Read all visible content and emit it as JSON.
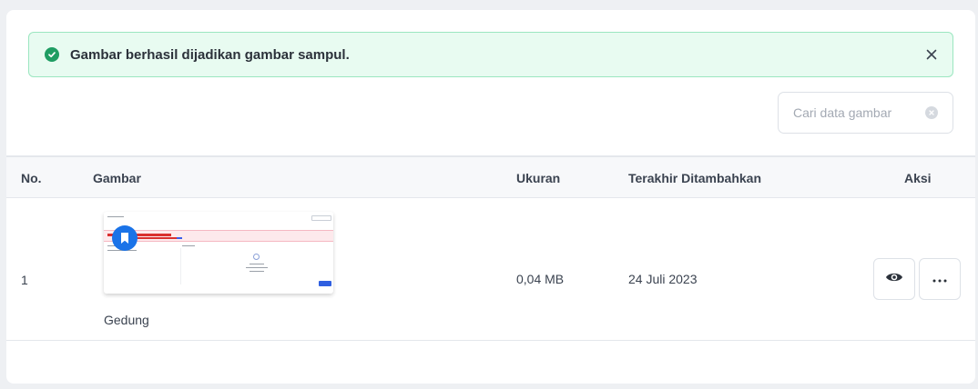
{
  "alert": {
    "message": "Gambar berhasil dijadikan gambar sampul.",
    "status_color": "#1f9d63"
  },
  "search": {
    "placeholder": "Cari data gambar",
    "value": ""
  },
  "table": {
    "columns": [
      "No.",
      "Gambar",
      "Ukuran",
      "Terakhir Ditambahkan",
      "Aksi"
    ],
    "rows": [
      {
        "no": "1",
        "name": "Gedung",
        "size": "0,04 MB",
        "date": "24 Juli 2023",
        "cover_badge_icon": "bookmark-icon"
      }
    ]
  },
  "actions": {
    "view_icon": "eye-icon",
    "more_icon": "more-horizontal-icon"
  },
  "colors": {
    "accent": "#1a73e8",
    "alert_bg": "#e8fbf1"
  }
}
